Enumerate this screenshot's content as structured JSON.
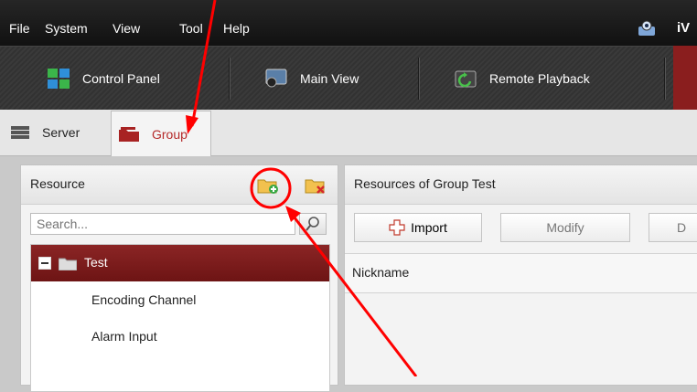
{
  "menubar": {
    "items": [
      "File",
      "System",
      "View",
      "Tool",
      "Help"
    ],
    "app_name": "iV"
  },
  "toolbar": {
    "items": [
      "Control Panel",
      "Main View",
      "Remote Playback"
    ]
  },
  "tabs": [
    "Server",
    "Group"
  ],
  "resource_panel": {
    "title": "Resource",
    "search_placeholder": "Search...",
    "tree": [
      {
        "label": "Test",
        "selected": true
      },
      {
        "label": "Encoding Channel"
      },
      {
        "label": "Alarm Input"
      }
    ]
  },
  "group_panel": {
    "title": "Resources of Group Test",
    "buttons": [
      "Import",
      "Modify",
      "D"
    ],
    "column": "Nickname"
  },
  "colors": {
    "accent": "#b52a2a",
    "selected_row": "#7a1b1b",
    "annotation": "#ff0000"
  }
}
